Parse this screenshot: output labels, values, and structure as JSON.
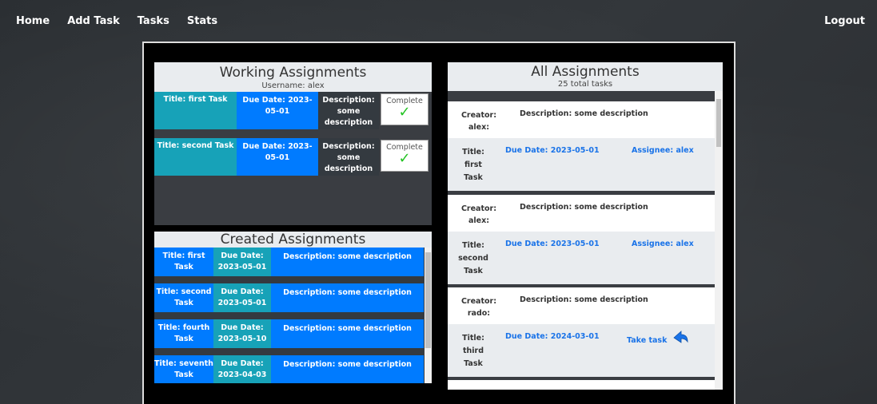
{
  "nav": {
    "home": "Home",
    "add_task": "Add Task",
    "tasks": "Tasks",
    "stats": "Stats",
    "logout": "Logout"
  },
  "working": {
    "title": "Working Assignments",
    "subtitle": "Username: alex",
    "complete_label": "Complete",
    "items": [
      {
        "title": "Title: first Task",
        "due": "Due Date: 2023-05-01",
        "description": "Description: some description"
      },
      {
        "title": "Title: second Task",
        "due": "Due Date: 2023-05-01",
        "description": "Description: some description"
      }
    ]
  },
  "created": {
    "title": "Created Assignments",
    "items": [
      {
        "title": "Title: first Task",
        "due": "Due Date: 2023-05-01",
        "description": "Description: some description"
      },
      {
        "title": "Title: second Task",
        "due": "Due Date: 2023-05-01",
        "description": "Description: some description"
      },
      {
        "title": "Title: fourth Task",
        "due": "Due Date: 2023-05-10",
        "description": "Description: some description"
      },
      {
        "title": "Title: seventh Task",
        "due": "Due Date: 2023-04-03",
        "description": "Description: some description"
      }
    ]
  },
  "all": {
    "title": "All Assignments",
    "subtitle": "25 total tasks",
    "items": [
      {
        "creator": "Creator: alex:",
        "description": "Description: some description",
        "title": "Title: first Task",
        "due": "Due Date: 2023-05-01",
        "assignee": "Assignee: alex",
        "take": ""
      },
      {
        "creator": "Creator: alex:",
        "description": "Description: some description",
        "title": "Title: second Task",
        "due": "Due Date: 2023-05-01",
        "assignee": "Assignee: alex",
        "take": ""
      },
      {
        "creator": "Creator: rado:",
        "description": "Description: some description",
        "title": "Title: third Task",
        "due": "Due Date: 2024-03-01",
        "assignee": "",
        "take": "Take task"
      }
    ]
  },
  "colors": {
    "teal": "#17a2b8",
    "blue": "#007bff",
    "dark": "#343a40",
    "link": "#1a73e8",
    "check": "#22c322"
  },
  "icons": [
    "checkmark-icon",
    "take-task-arrow-icon"
  ]
}
